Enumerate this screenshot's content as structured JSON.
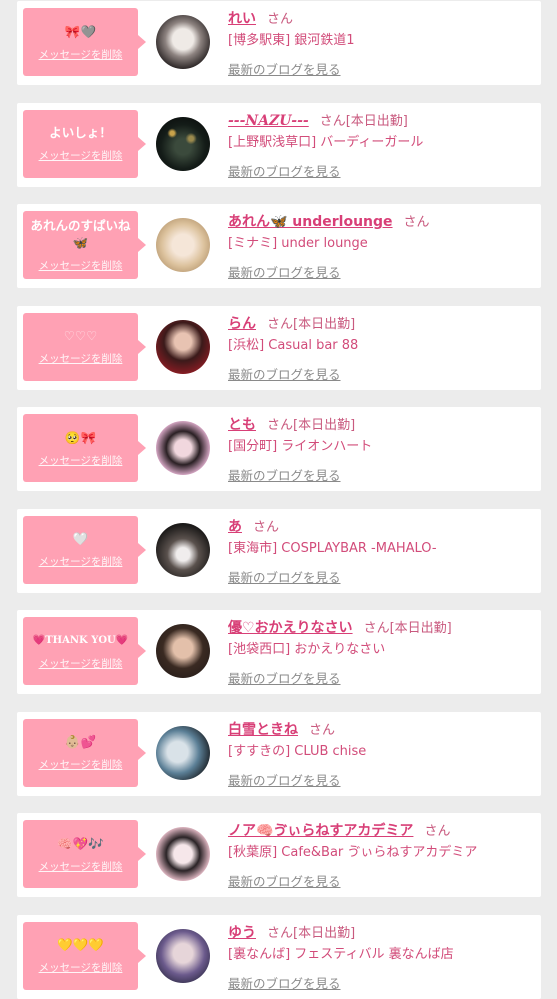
{
  "theme": {
    "page_background": "#ececec",
    "card_background": "#ffffff",
    "bubble_pink": "#ffa1b4",
    "name_pink": "#d83f77",
    "text_pink": "#d24c7a",
    "sub_pink": "#c95a7f",
    "link_gray": "#8a8a8a"
  },
  "cards": [
    {
      "message": "🎀🩶",
      "delete_label": "メッセージを削除",
      "name": "れい",
      "honorific": "さん",
      "area": "[博多駅東]",
      "shop": "銀河鉄道1",
      "blog_link": "最新のブログを見る"
    },
    {
      "message": "よいしょ！",
      "delete_label": "メッセージを削除",
      "name": "---NAZU---",
      "honorific": "さん",
      "shift_badge": "[本日出勤]",
      "area": "[上野駅浅草口]",
      "shop": "バーディーガール",
      "blog_link": "最新のブログを見る"
    },
    {
      "message": "あれんのすぱいね🦋",
      "delete_label": "メッセージを削除",
      "name": "あれん🦋 underlounge",
      "honorific": "さん",
      "area": "[ミナミ]",
      "shop": "under lounge",
      "blog_link": "最新のブログを見る"
    },
    {
      "message": "♡♡♡",
      "delete_label": "メッセージを削除",
      "name": "らん",
      "honorific": "さん",
      "shift_badge": "[本日出勤]",
      "area": "[浜松]",
      "shop": "Casual bar 88",
      "blog_link": "最新のブログを見る"
    },
    {
      "message": "🥺🎀",
      "delete_label": "メッセージを削除",
      "name": "とも",
      "honorific": "さん",
      "shift_badge": "[本日出勤]",
      "area": "[国分町]",
      "shop": "ライオンハート",
      "blog_link": "最新のブログを見る"
    },
    {
      "message": "🤍",
      "delete_label": "メッセージを削除",
      "name": "あ",
      "honorific": "さん",
      "area": "[東海市]",
      "shop": "COSPLAYBAR -MAHALO-",
      "blog_link": "最新のブログを見る"
    },
    {
      "message": "💗THANK YOU💗",
      "delete_label": "メッセージを削除",
      "name": "優♡おかえりなさい",
      "honorific": "さん",
      "shift_badge": "[本日出勤]",
      "area": "[池袋西口]",
      "shop": "おかえりなさい",
      "blog_link": "最新のブログを見る"
    },
    {
      "message": "👶🏼💕",
      "delete_label": "メッセージを削除",
      "name": "白雪ときね",
      "honorific": "さん",
      "area": "[すすきの]",
      "shop": "CLUB chise",
      "blog_link": "最新のブログを見る"
    },
    {
      "message": "🧠💖🎶",
      "delete_label": "メッセージを削除",
      "name": "ノア🧠ゔぃらねすアカデミア",
      "honorific": "さん",
      "area": "[秋葉原]",
      "shop": "Cafe&Bar ゔぃらねすアカデミア",
      "blog_link": "最新のブログを見る"
    },
    {
      "message": "💛💛💛",
      "delete_label": "メッセージを削除",
      "name": "ゆう",
      "honorific": "さん",
      "shift_badge": "[本日出勤]",
      "area": "[裏なんば]",
      "shop": "フェスティバル 裏なんば店",
      "blog_link": "最新のブログを見る"
    }
  ]
}
